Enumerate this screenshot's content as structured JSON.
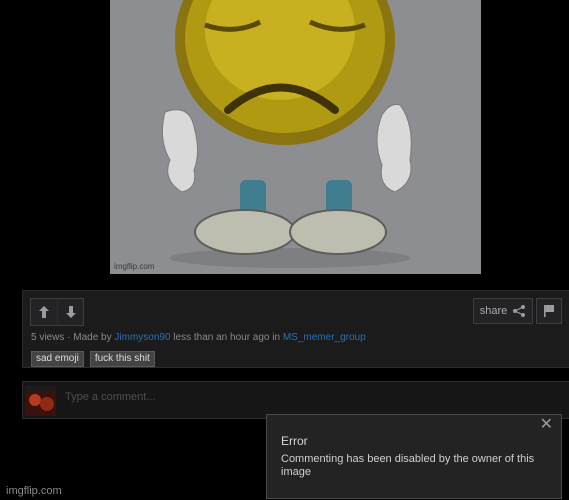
{
  "meme": {
    "watermark": "imgflip.com"
  },
  "voting": {
    "upvote_icon": "arrow-up-icon",
    "downvote_icon": "arrow-down-icon"
  },
  "share": {
    "label": "share",
    "icon": "share-icon"
  },
  "flag": {
    "icon": "flag-icon"
  },
  "meta": {
    "views": "5 views",
    "made_by_prefix": " · Made by ",
    "author": "Jimmyson90",
    "time_prefix": " less than an hour ago in ",
    "stream": "MS_memer_group"
  },
  "tags": [
    "sad emoji",
    "fuck this shit"
  ],
  "comment": {
    "placeholder": "Type a comment..."
  },
  "error_popup": {
    "close_label": "✕",
    "title": "Error",
    "message": "Commenting has been disabled by the owner of this image"
  },
  "site_watermark": "imgflip.com",
  "colors": {
    "background": "#000000",
    "panel": "#1b1b1c",
    "link": "#2a6fb0",
    "tag_bg": "#444444"
  }
}
